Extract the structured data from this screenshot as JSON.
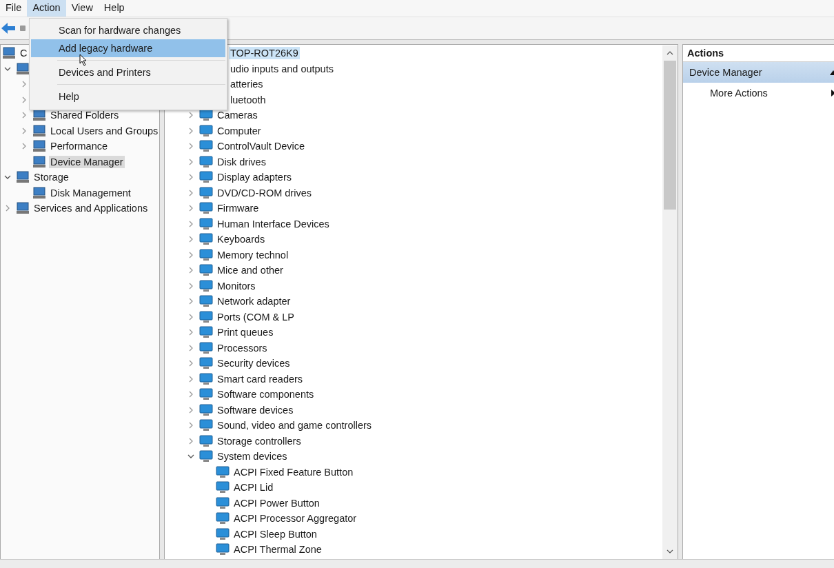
{
  "menu_bar": [
    {
      "label": "File",
      "selected": false
    },
    {
      "label": "Action",
      "selected": true
    },
    {
      "label": "View",
      "selected": false
    },
    {
      "label": "Help",
      "selected": false
    }
  ],
  "action_menu": {
    "items": [
      {
        "kind": "item",
        "label": "Scan for hardware changes",
        "selected": false
      },
      {
        "kind": "item",
        "label": "Add legacy hardware",
        "selected": true
      },
      {
        "kind": "separator"
      },
      {
        "kind": "item",
        "label": "Devices and Printers",
        "selected": false
      },
      {
        "kind": "separator"
      },
      {
        "kind": "item",
        "label": "Help",
        "selected": false
      }
    ]
  },
  "left_tree": [
    {
      "label": "C",
      "selected": false,
      "children": [
        {
          "expanded": true,
          "children": [
            {
              "expanded": false
            },
            {
              "expanded": false
            },
            {
              "label": "Shared Folders",
              "selected": false,
              "expanded": false
            },
            {
              "label": "Local Users and Groups",
              "selected": false,
              "expanded": false
            },
            {
              "label": "Performance",
              "selected": false,
              "expanded": false
            },
            {
              "label": "Device Manager",
              "selected": true
            }
          ]
        },
        {
          "label": "Storage",
          "selected": false,
          "expanded": true,
          "children": [
            {
              "label": "Disk Management",
              "selected": false
            }
          ]
        },
        {
          "label": "Services and Applications",
          "selected": false,
          "expanded": false
        }
      ]
    }
  ],
  "device_tree": [
    {
      "label": "TOP-ROT26K9",
      "kind": "partly_hidden",
      "selected": true,
      "children": [
        {
          "label": "udio inputs and outputs",
          "kind": "partly_hidden",
          "selected": false
        },
        {
          "label": "atteries",
          "kind": "partly_hidden",
          "selected": false
        },
        {
          "label": "luetooth",
          "kind": "partly_hidden",
          "selected": false
        },
        {
          "label": "Cameras",
          "kind": "row",
          "selected": false,
          "expanded": false
        },
        {
          "label": "Computer",
          "kind": "row",
          "selected": false,
          "expanded": false
        },
        {
          "label": "ControlVault Device",
          "kind": "row",
          "selected": false,
          "expanded": false
        },
        {
          "label": "Disk drives",
          "kind": "row",
          "selected": false,
          "expanded": false
        },
        {
          "label": "Display adapters",
          "kind": "row",
          "selected": false,
          "expanded": false
        },
        {
          "label": "DVD/CD-ROM drives",
          "kind": "row",
          "selected": false,
          "expanded": false
        },
        {
          "label": "Firmware",
          "kind": "row",
          "selected": false,
          "expanded": false
        },
        {
          "label": "Human Interface Devices",
          "kind": "row",
          "selected": false,
          "expanded": false
        },
        {
          "label": "Keyboards",
          "kind": "row",
          "selected": false,
          "expanded": false
        },
        {
          "label": "Memory technol",
          "kind": "row",
          "selected": false,
          "expanded": false
        },
        {
          "label": "Mice and other",
          "kind": "row",
          "selected": false,
          "expanded": false
        },
        {
          "label": "Monitors",
          "kind": "row",
          "selected": false,
          "expanded": false
        },
        {
          "label": "Network adapter",
          "kind": "row",
          "selected": false,
          "expanded": false
        },
        {
          "label": "Ports (COM & LP",
          "kind": "row",
          "selected": false,
          "expanded": false
        },
        {
          "label": "Print queues",
          "kind": "row",
          "selected": false,
          "expanded": false
        },
        {
          "label": "Processors",
          "kind": "row",
          "selected": false,
          "expanded": false
        },
        {
          "label": "Security devices",
          "kind": "row",
          "selected": false,
          "expanded": false
        },
        {
          "label": "Smart card readers",
          "kind": "row",
          "selected": false,
          "expanded": false
        },
        {
          "label": "Software components",
          "kind": "row",
          "selected": false,
          "expanded": false
        },
        {
          "label": "Software devices",
          "kind": "row",
          "selected": false,
          "expanded": false
        },
        {
          "label": "Sound, video and game controllers",
          "kind": "row",
          "selected": false,
          "expanded": false
        },
        {
          "label": "Storage controllers",
          "kind": "row",
          "selected": false,
          "expanded": false
        },
        {
          "label": "System devices",
          "kind": "row",
          "selected": false,
          "expanded": true,
          "children": [
            {
              "label": "ACPI Fixed Feature Button",
              "kind": "row",
              "selected": false
            },
            {
              "label": "ACPI Lid",
              "kind": "row",
              "selected": false
            },
            {
              "label": "ACPI Power Button",
              "kind": "row",
              "selected": false
            },
            {
              "label": "ACPI Processor Aggregator",
              "kind": "row",
              "selected": false
            },
            {
              "label": "ACPI Sleep Button",
              "kind": "row",
              "selected": false
            },
            {
              "label": "ACPI Thermal Zone",
              "kind": "row",
              "selected": false
            }
          ]
        }
      ]
    }
  ],
  "actions_pane": {
    "title": "Actions",
    "items": [
      {
        "label": "Device Manager",
        "kind": "group",
        "selected": true,
        "expanded": true
      },
      {
        "label": "More Actions",
        "kind": "submenu",
        "selected": false
      }
    ]
  }
}
